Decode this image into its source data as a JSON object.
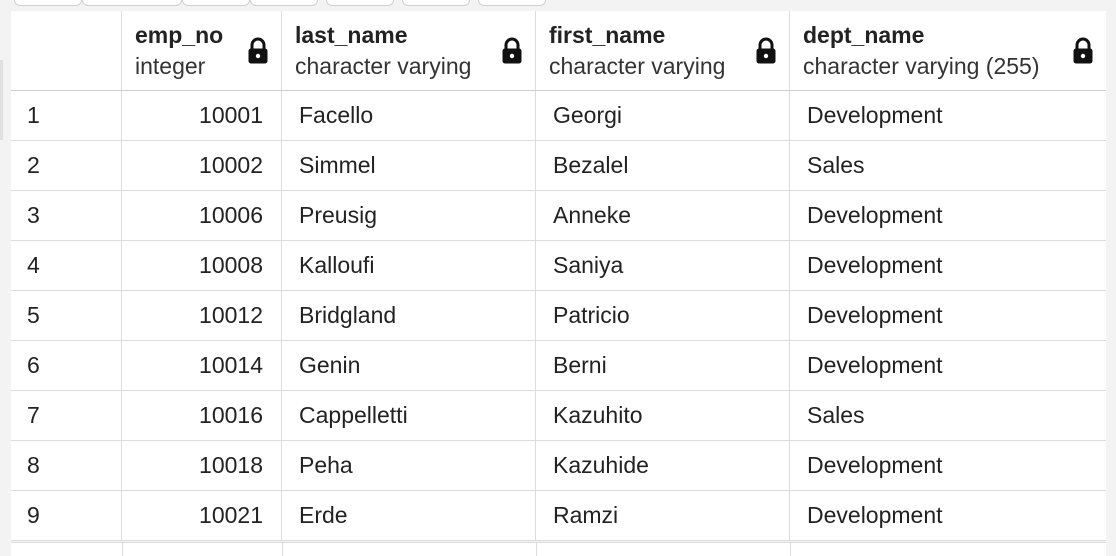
{
  "columns": [
    {
      "name": "emp_no",
      "type": "integer"
    },
    {
      "name": "last_name",
      "type": "character varying"
    },
    {
      "name": "first_name",
      "type": "character varying"
    },
    {
      "name": "dept_name",
      "type": "character varying (255)"
    }
  ],
  "rows": [
    {
      "idx": "1",
      "emp_no": "10001",
      "last_name": "Facello",
      "first_name": "Georgi",
      "dept_name": "Development"
    },
    {
      "idx": "2",
      "emp_no": "10002",
      "last_name": "Simmel",
      "first_name": "Bezalel",
      "dept_name": "Sales"
    },
    {
      "idx": "3",
      "emp_no": "10006",
      "last_name": "Preusig",
      "first_name": "Anneke",
      "dept_name": "Development"
    },
    {
      "idx": "4",
      "emp_no": "10008",
      "last_name": "Kalloufi",
      "first_name": "Saniya",
      "dept_name": "Development"
    },
    {
      "idx": "5",
      "emp_no": "10012",
      "last_name": "Bridgland",
      "first_name": "Patricio",
      "dept_name": "Development"
    },
    {
      "idx": "6",
      "emp_no": "10014",
      "last_name": "Genin",
      "first_name": "Berni",
      "dept_name": "Development"
    },
    {
      "idx": "7",
      "emp_no": "10016",
      "last_name": "Cappelletti",
      "first_name": "Kazuhito",
      "dept_name": "Sales"
    },
    {
      "idx": "8",
      "emp_no": "10018",
      "last_name": "Peha",
      "first_name": "Kazuhide",
      "dept_name": "Development"
    },
    {
      "idx": "9",
      "emp_no": "10021",
      "last_name": "Erde",
      "first_name": "Ramzi",
      "dept_name": "Development"
    }
  ],
  "icons": {
    "column_lock": "lock-icon"
  },
  "colors": {
    "grid_border": "#dcdcdc",
    "background": "#f3f3f3",
    "text": "#222222"
  }
}
